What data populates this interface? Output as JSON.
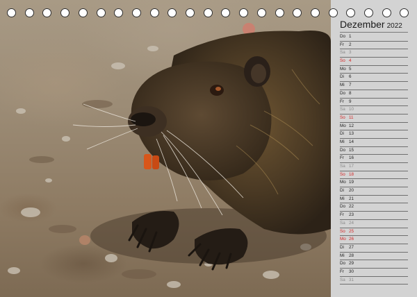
{
  "calendar": {
    "month": "Dezember",
    "year": "2022",
    "days": [
      {
        "wd": "Do",
        "d": "1",
        "type": "weekday"
      },
      {
        "wd": "Fr",
        "d": "2",
        "type": "weekday"
      },
      {
        "wd": "Sa",
        "d": "3",
        "type": "sat"
      },
      {
        "wd": "So",
        "d": "4",
        "type": "sun"
      },
      {
        "wd": "Mo",
        "d": "5",
        "type": "weekday"
      },
      {
        "wd": "Di",
        "d": "6",
        "type": "weekday"
      },
      {
        "wd": "Mi",
        "d": "7",
        "type": "weekday"
      },
      {
        "wd": "Do",
        "d": "8",
        "type": "weekday"
      },
      {
        "wd": "Fr",
        "d": "9",
        "type": "weekday"
      },
      {
        "wd": "Sa",
        "d": "10",
        "type": "sat"
      },
      {
        "wd": "So",
        "d": "11",
        "type": "sun"
      },
      {
        "wd": "Mo",
        "d": "12",
        "type": "weekday"
      },
      {
        "wd": "Di",
        "d": "13",
        "type": "weekday"
      },
      {
        "wd": "Mi",
        "d": "14",
        "type": "weekday"
      },
      {
        "wd": "Do",
        "d": "15",
        "type": "weekday"
      },
      {
        "wd": "Fr",
        "d": "16",
        "type": "weekday"
      },
      {
        "wd": "Sa",
        "d": "17",
        "type": "sat"
      },
      {
        "wd": "So",
        "d": "18",
        "type": "sun"
      },
      {
        "wd": "Mo",
        "d": "19",
        "type": "weekday"
      },
      {
        "wd": "Di",
        "d": "20",
        "type": "weekday"
      },
      {
        "wd": "Mi",
        "d": "21",
        "type": "weekday"
      },
      {
        "wd": "Do",
        "d": "22",
        "type": "weekday"
      },
      {
        "wd": "Fr",
        "d": "23",
        "type": "weekday"
      },
      {
        "wd": "Sa",
        "d": "24",
        "type": "sat"
      },
      {
        "wd": "So",
        "d": "25",
        "type": "sun"
      },
      {
        "wd": "Mo",
        "d": "26",
        "type": "sun"
      },
      {
        "wd": "Di",
        "d": "27",
        "type": "weekday"
      },
      {
        "wd": "Mi",
        "d": "28",
        "type": "weekday"
      },
      {
        "wd": "Do",
        "d": "29",
        "type": "weekday"
      },
      {
        "wd": "Fr",
        "d": "30",
        "type": "weekday"
      },
      {
        "wd": "Sa",
        "d": "31",
        "type": "sat"
      }
    ]
  },
  "binding": {
    "hole_count": 23
  },
  "colors": {
    "panel": "#d3d3d3",
    "sunday_holiday": "#d42828",
    "saturday": "#8a8a8a",
    "text": "#1e1e1e"
  },
  "photo": {
    "subject": "nutria-on-gravel"
  }
}
